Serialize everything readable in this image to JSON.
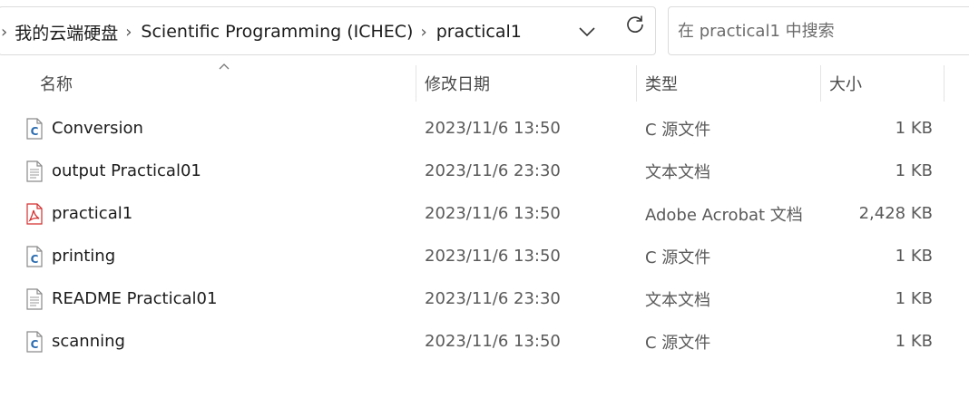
{
  "address": {
    "breadcrumbs": [
      "我的云端硬盘",
      "Scientific Programming (ICHEC)",
      "practical1"
    ],
    "search_placeholder": "在 practical1 中搜索"
  },
  "columns": {
    "name": "名称",
    "date": "修改日期",
    "type": "类型",
    "size": "大小"
  },
  "files": [
    {
      "name": "Conversion",
      "date": "2023/11/6 13:50",
      "type": "C 源文件",
      "size": "1 KB",
      "icon": "c-source-file-icon"
    },
    {
      "name": "output Practical01",
      "date": "2023/11/6 23:30",
      "type": "文本文档",
      "size": "1 KB",
      "icon": "text-document-icon"
    },
    {
      "name": "practical1",
      "date": "2023/11/6 13:50",
      "type": "Adobe Acrobat 文档",
      "size": "2,428 KB",
      "icon": "pdf-file-icon"
    },
    {
      "name": "printing",
      "date": "2023/11/6 13:50",
      "type": "C 源文件",
      "size": "1 KB",
      "icon": "c-source-file-icon"
    },
    {
      "name": "README Practical01",
      "date": "2023/11/6 23:30",
      "type": "文本文档",
      "size": "1 KB",
      "icon": "text-document-icon"
    },
    {
      "name": "scanning",
      "date": "2023/11/6 13:50",
      "type": "C 源文件",
      "size": "1 KB",
      "icon": "c-source-file-icon"
    }
  ],
  "colors": {
    "c_icon_accent": "#2b6cb0",
    "pdf_red": "#d32f2f",
    "border": "#dcdcdc"
  }
}
